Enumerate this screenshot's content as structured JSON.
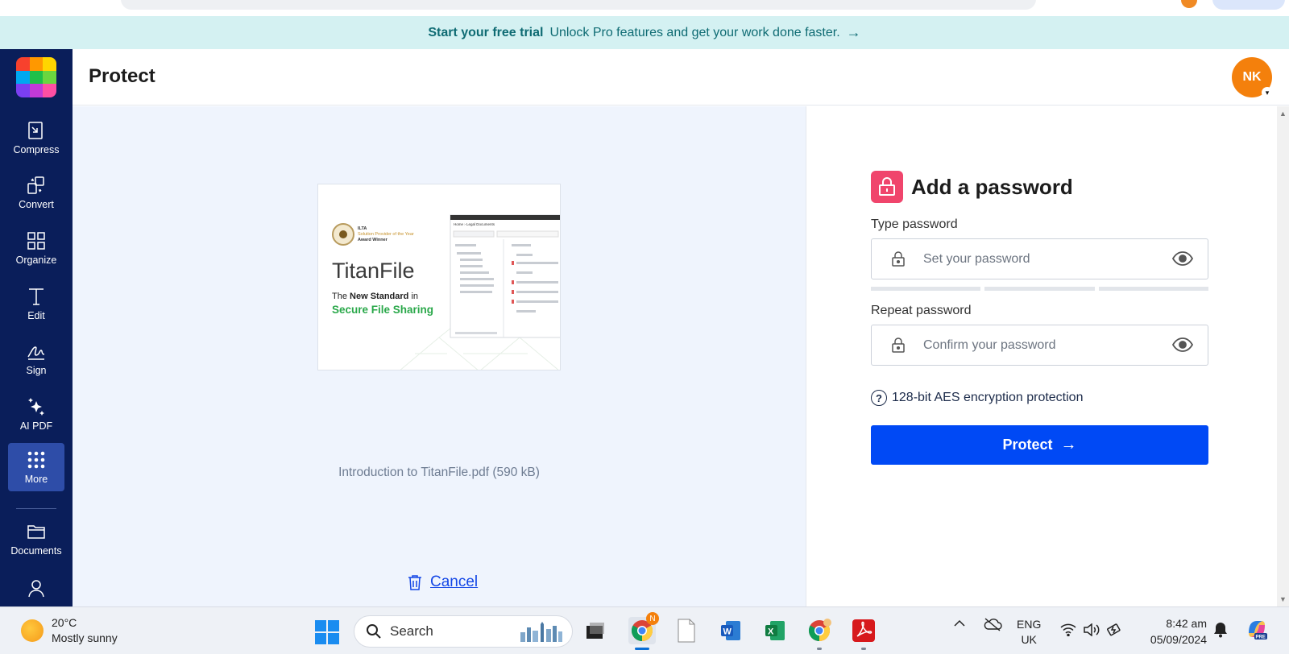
{
  "banner": {
    "cta_bold": "Start your free trial",
    "cta_text": "Unlock Pro features and get your work done faster.",
    "arrow": "→"
  },
  "sidebar": {
    "items": [
      {
        "label": "Compress",
        "icon": "compress-icon"
      },
      {
        "label": "Convert",
        "icon": "convert-icon"
      },
      {
        "label": "Organize",
        "icon": "organize-icon"
      },
      {
        "label": "Edit",
        "icon": "edit-icon"
      },
      {
        "label": "Sign",
        "icon": "sign-icon"
      },
      {
        "label": "AI PDF",
        "icon": "sparkle-icon"
      },
      {
        "label": "More",
        "icon": "grid-dots-icon",
        "active": true
      },
      {
        "label": "Documents",
        "icon": "folder-icon"
      }
    ],
    "logo_colors": [
      "#f7412d",
      "#ff9800",
      "#ffd600",
      "#00a8f0",
      "#1fbf4a",
      "#6ad63f",
      "#7b3ff2",
      "#c23ad8",
      "#ff4fa3"
    ]
  },
  "header": {
    "title": "Protect",
    "avatar_initials": "NK"
  },
  "preview": {
    "thumbnail": {
      "badge_line1": "ILTA",
      "badge_line2": "Solution Provider of the Year",
      "badge_line3": "Award Winner",
      "brand": "TitanFile",
      "tagline_prefix": "The",
      "tagline_bold": "New Standard",
      "tagline_suffix": "in",
      "tagline_green": "Secure File Sharing",
      "window_title": "Home › Legal Documents"
    },
    "file_caption": "Introduction to TitanFile.pdf (590 kB)",
    "cancel_label": "Cancel"
  },
  "panel": {
    "heading": "Add a password",
    "type_label": "Type password",
    "type_placeholder": "Set your password",
    "repeat_label": "Repeat password",
    "repeat_placeholder": "Confirm your password",
    "aes_note": "128-bit AES encryption protection",
    "protect_label": "Protect",
    "protect_arrow": "→",
    "accent": "#0049f5",
    "lock_color": "#f0456c"
  },
  "taskbar": {
    "temperature": "20°C",
    "weather": "Mostly sunny",
    "search_label": "Search",
    "chrome_badge": "N",
    "lang_line1": "ENG",
    "lang_line2": "UK",
    "time": "8:42 am",
    "date": "05/09/2024"
  }
}
